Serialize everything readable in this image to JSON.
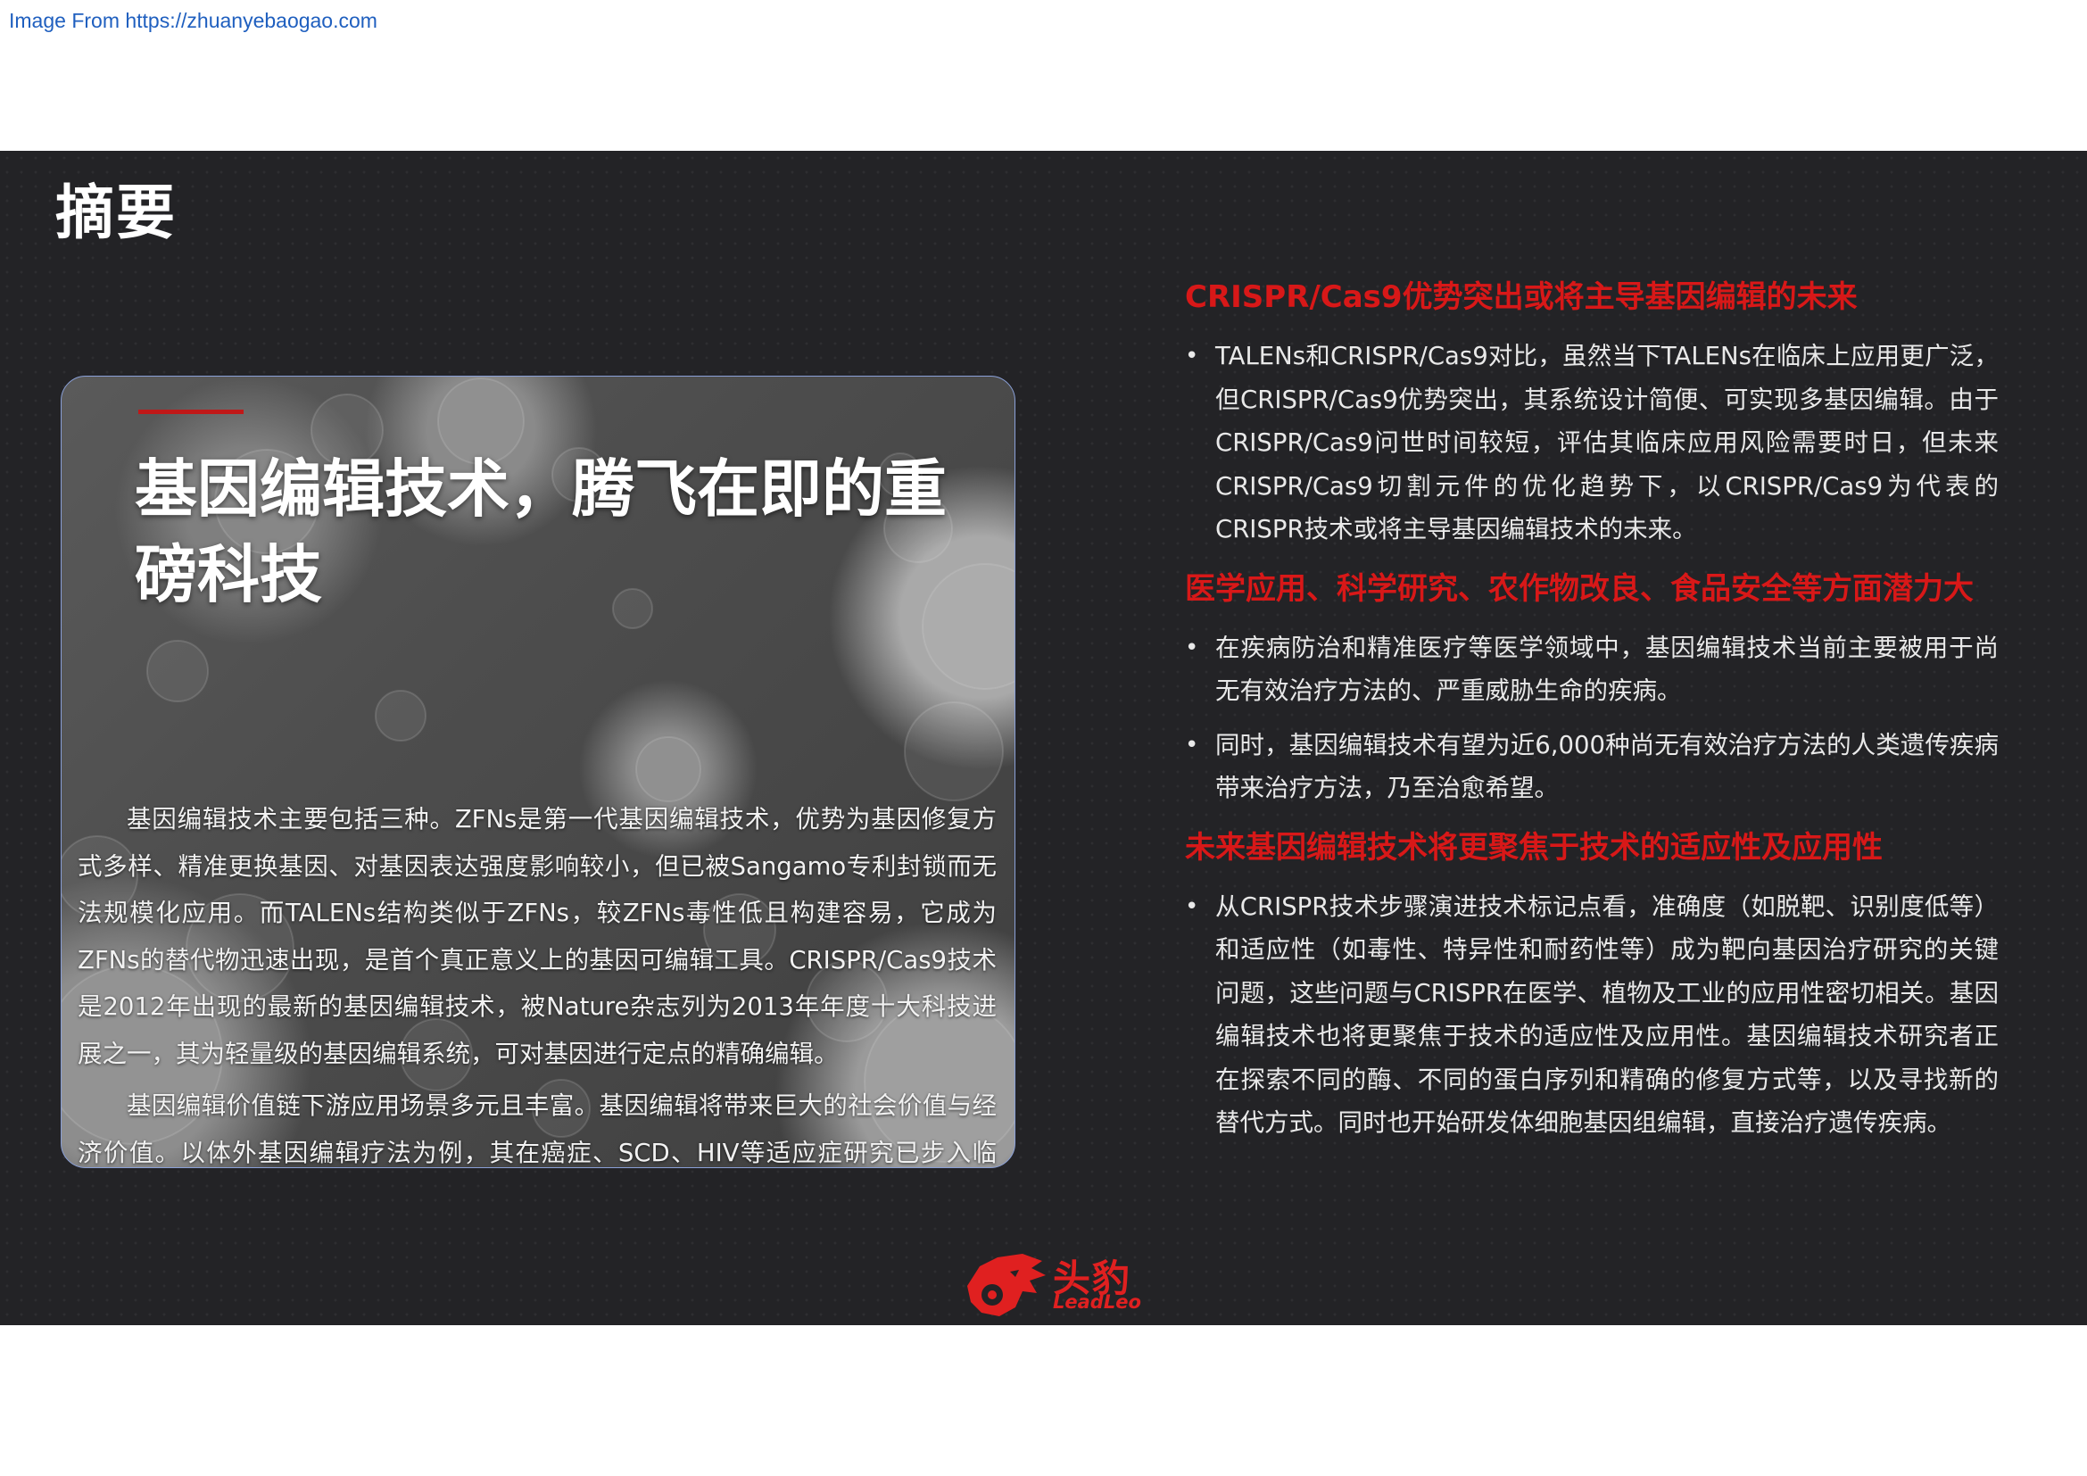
{
  "source": {
    "text": "Image From https://zhuanyebaogao.com"
  },
  "slide": {
    "title": "摘要",
    "card": {
      "title_line1": "基因编辑技术，腾飞在即的重",
      "title_line2": "磅科技",
      "paragraphs": [
        "基因编辑技术主要包括三种。ZFNs是第一代基因编辑技术，优势为基因修复方式多样、精准更换基因、对基因表达强度影响较小，但已被Sangamo专利封锁而无法规模化应用。而TALENs结构类似于ZFNs，较ZFNs毒性低且构建容易，它成为ZFNs的替代物迅速出现，是首个真正意义上的基因可编辑工具。CRISPR/Cas9技术是2012年出现的最新的基因编辑技术，被Nature杂志列为2013年年度十大科技进展之一，其为轻量级的基因编辑系统，可对基因进行定点的精确编辑。",
        "基因编辑价值链下游应用场景多元且丰富。基因编辑将带来巨大的社会价值与经济价值。以体外基因编辑疗法为例，其在癌症、SCD、HIV等适应症研究已步入临床，而对标单抗药物飞速发展的轨迹，预计未来基因编辑疗法将步入腾飞阶段。"
      ]
    },
    "sections": [
      {
        "heading": "CRISPR/Cas9优势突出或将主导基因编辑的未来",
        "bullets": [
          "TALENs和CRISPR/Cas9对比，虽然当下TALENs在临床上应用更广泛，但CRISPR/Cas9优势突出，其系统设计简便、可实现多基因编辑。由于CRISPR/Cas9问世时间较短，评估其临床应用风险需要时日，但未来CRISPR/Cas9切割元件的优化趋势下，以CRISPR/Cas9为代表的CRISPR技术或将主导基因编辑技术的未来。"
        ]
      },
      {
        "heading": "医学应用、科学研究、农作物改良、食品安全等方面潜力大",
        "bullets": [
          "在疾病防治和精准医疗等医学领域中，基因编辑技术当前主要被用于尚无有效治疗方法的、严重威胁生命的疾病。",
          "同时，基因编辑技术有望为近6,000种尚无有效治疗方法的人类遗传疾病带来治疗方法，乃至治愈希望。"
        ]
      },
      {
        "heading": "未来基因编辑技术将更聚焦于技术的适应性及应用性",
        "bullets": [
          "从CRISPR技术步骤演进技术标记点看，准确度（如脱靶、识别度低等）和适应性（如毒性、特异性和耐药性等）成为靶向基因治疗研究的关键问题，这些问题与CRISPR在医学、植物及工业的应用性密切相关。基因编辑技术也将更聚焦于技术的适应性及应用性。基因编辑技术研究者正在探索不同的酶、不同的蛋白序列和精确的修复方式等，以及寻找新的替代方式。同时也开始研发体细胞基因组编辑，直接治疗遗传疾病。"
        ]
      }
    ],
    "logo": {
      "cn": "头豹",
      "en": "LeadLeo",
      "icon": "leopard-head-logo-icon"
    },
    "colors": {
      "accent": "#d81818",
      "background": "#232326",
      "text": "#e9e9e9"
    }
  }
}
